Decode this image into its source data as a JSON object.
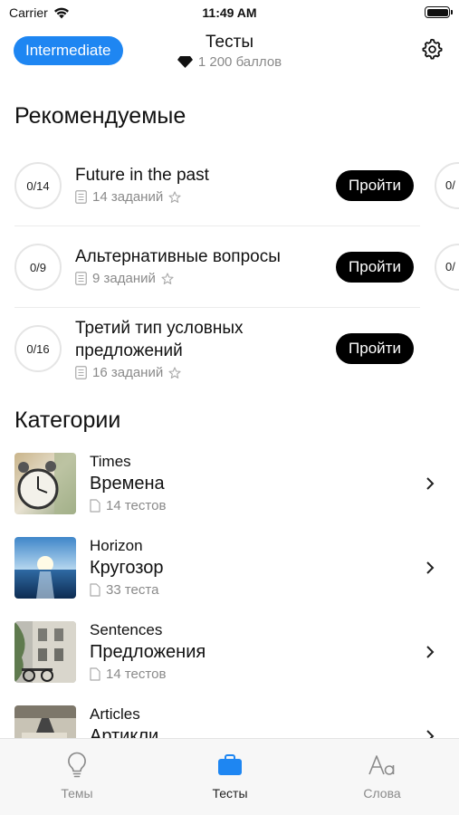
{
  "status": {
    "carrier": "Carrier",
    "time": "11:49 AM"
  },
  "header": {
    "level": "Intermediate",
    "title": "Тесты",
    "points": "1 200 баллов"
  },
  "colors": {
    "accent": "#1e86f2",
    "button": "#000000",
    "muted": "#8a8a8a"
  },
  "recommended": {
    "heading": "Рекомендуемые",
    "items": [
      {
        "progress": "0/14",
        "title": "Future in the past",
        "tasks": "14 заданий",
        "button": "Пройти",
        "peek": "0/"
      },
      {
        "progress": "0/9",
        "title": "Альтернативные вопросы",
        "tasks": "9 заданий",
        "button": "Пройти",
        "peek": "0/"
      },
      {
        "progress": "0/16",
        "title": "Третий тип условных предложений",
        "tasks": "16 заданий",
        "button": "Пройти"
      }
    ]
  },
  "categories": {
    "heading": "Категории",
    "items": [
      {
        "en": "Times",
        "ru": "Времена",
        "count": "14 тестов",
        "icon": "clock-image"
      },
      {
        "en": "Horizon",
        "ru": "Кругозор",
        "count": "33 теста",
        "icon": "sea-horizon-image"
      },
      {
        "en": "Sentences",
        "ru": "Предложения",
        "count": "14 тестов",
        "icon": "building-image"
      },
      {
        "en": "Articles",
        "ru": "Артикли",
        "count": "",
        "icon": "lamp-image"
      }
    ]
  },
  "tabs": [
    {
      "label": "Темы",
      "icon": "lightbulb-icon"
    },
    {
      "label": "Тесты",
      "icon": "briefcase-icon",
      "active": true
    },
    {
      "label": "Слова",
      "icon": "text-format-icon"
    }
  ]
}
